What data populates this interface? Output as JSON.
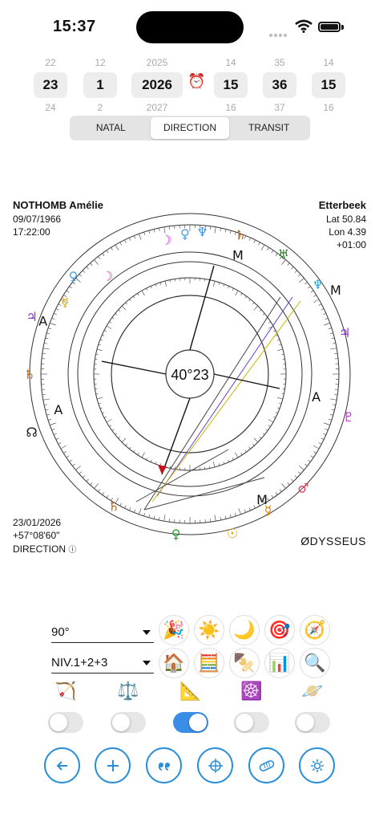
{
  "status": {
    "time": "15:37"
  },
  "pickers": [
    {
      "prev": "22",
      "value": "23",
      "next": "24"
    },
    {
      "prev": "12",
      "value": "1",
      "next": "2"
    },
    {
      "prev": "2025",
      "value": "2026",
      "next": "2027"
    },
    {
      "prev": "14",
      "value": "15",
      "next": "16"
    },
    {
      "prev": "35",
      "value": "36",
      "next": "37"
    },
    {
      "prev": "14",
      "value": "15",
      "next": "16"
    }
  ],
  "tabs": [
    {
      "label": "NATAL",
      "active": false
    },
    {
      "label": "DIRECTION",
      "active": true
    },
    {
      "label": "TRANSIT",
      "active": false
    }
  ],
  "person": {
    "name": "NOTHOMB Amélie",
    "date": "09/07/1966",
    "time": "17:22:00"
  },
  "place": {
    "name": "Etterbeek",
    "lat": "Lat 50.84",
    "lon": "Lon 4.39",
    "tz": "+01:00"
  },
  "direction": {
    "date": "23/01/2026",
    "arc": "+57°08'60\"",
    "mode": "DIRECTION"
  },
  "chart": {
    "center_label": "40°23",
    "brand": "DYSSEUS",
    "brand_mark": "Ø"
  },
  "controls": {
    "aspect_select": "90°",
    "level_select": "NIV.1+2+3",
    "row1_icons": [
      "🎉",
      "☀️",
      "🌙",
      "🎯",
      "🧭"
    ],
    "row1_names": [
      "party-popper-icon",
      "sun-icon",
      "moon-icon",
      "target-icon",
      "compass-icon"
    ],
    "row2_icons": [
      "🏠",
      "🧮",
      "🍢",
      "📊",
      "🔍"
    ],
    "row2_names": [
      "house-icon",
      "abacus-icon",
      "skewer-icon",
      "bar-chart-icon",
      "magnifier-icon"
    ],
    "glyphs": [
      "🏹",
      "⚖️",
      "📐",
      "☸️",
      "🪐"
    ],
    "glyph_names": [
      "bow-icon",
      "balance-scale-icon",
      "set-square-icon",
      "wheel-icon",
      "ringed-planet-icon"
    ],
    "toggles": [
      false,
      false,
      true,
      false,
      false
    ]
  },
  "bottom_nav": [
    "back-arrow-icon",
    "plus-icon",
    "quote-icon",
    "crosshair-icon",
    "pill-icon",
    "settings-icon"
  ],
  "colors": {
    "accent": "#2a8fd8",
    "toggle_on": "#3a8ee6"
  }
}
